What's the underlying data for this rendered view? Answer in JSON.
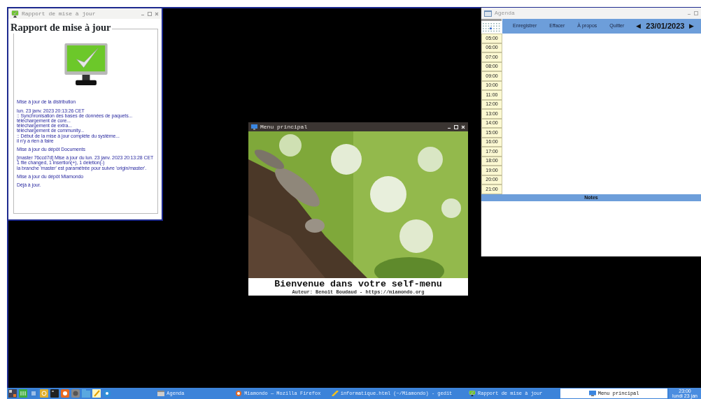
{
  "report_window": {
    "title": "Rapport de mise à jour",
    "heading": "Rapport de mise à jour",
    "paragraphs": [
      [
        "Mise à jour de la distribution"
      ],
      [
        "lun. 23 janv. 2023 20:13:26 CET",
        ":: Synchronisation des bases de données de paquets...",
        "téléchargement de core...",
        "téléchargement de extra...",
        "téléchargement de community...",
        ":: Début de la mise à jour complète du système...",
        "il n'y a rien à faire"
      ],
      [
        "Mise à jour du dépôt Documents"
      ],
      [
        "[master 76ccd7d] Mise à jour du lun. 23 janv. 2023 20:13:28 CET",
        "1 file changed, 1 insertion(+), 1 deletion(-)",
        "la branche 'master' est paramétrée pour suivre 'origin/master'."
      ],
      [
        "Mise à jour du dépôt Miamondo"
      ],
      [
        "Déjà à jour."
      ]
    ]
  },
  "agenda_window": {
    "title": "Agenda",
    "toolbar": [
      "Enregistrer",
      "Effacer",
      "À propos",
      "Quitter"
    ],
    "prev": "◀",
    "date": "23/01/2023",
    "next": "▶",
    "hours": [
      "05:00",
      "06:00",
      "07:00",
      "08:00",
      "09:00",
      "10:00",
      "11:00",
      "12:00",
      "13:00",
      "14:00",
      "15:00",
      "16:00",
      "17:00",
      "18:00",
      "19:00",
      "20:00",
      "21:00"
    ],
    "notes_header": "Notes"
  },
  "menu_window": {
    "title": "Menu principal",
    "welcome": "Bienvenue dans votre self-menu",
    "author": "Auteur: Benoît Boudaud - https://miamondo.org"
  },
  "taskbar": {
    "tasks": [
      {
        "label": "Agenda",
        "selected": false
      },
      {
        "label": "Miamondo — Mozilla Firefox",
        "selected": false
      },
      {
        "label": "informatique.html (~/Miamondo) - gedit",
        "selected": false
      },
      {
        "label": "Rapport de mise à jour",
        "selected": false
      },
      {
        "label": "Menu principal",
        "selected": true
      }
    ],
    "clock": {
      "time": "23:00",
      "date": "lundi 23 jan"
    }
  }
}
